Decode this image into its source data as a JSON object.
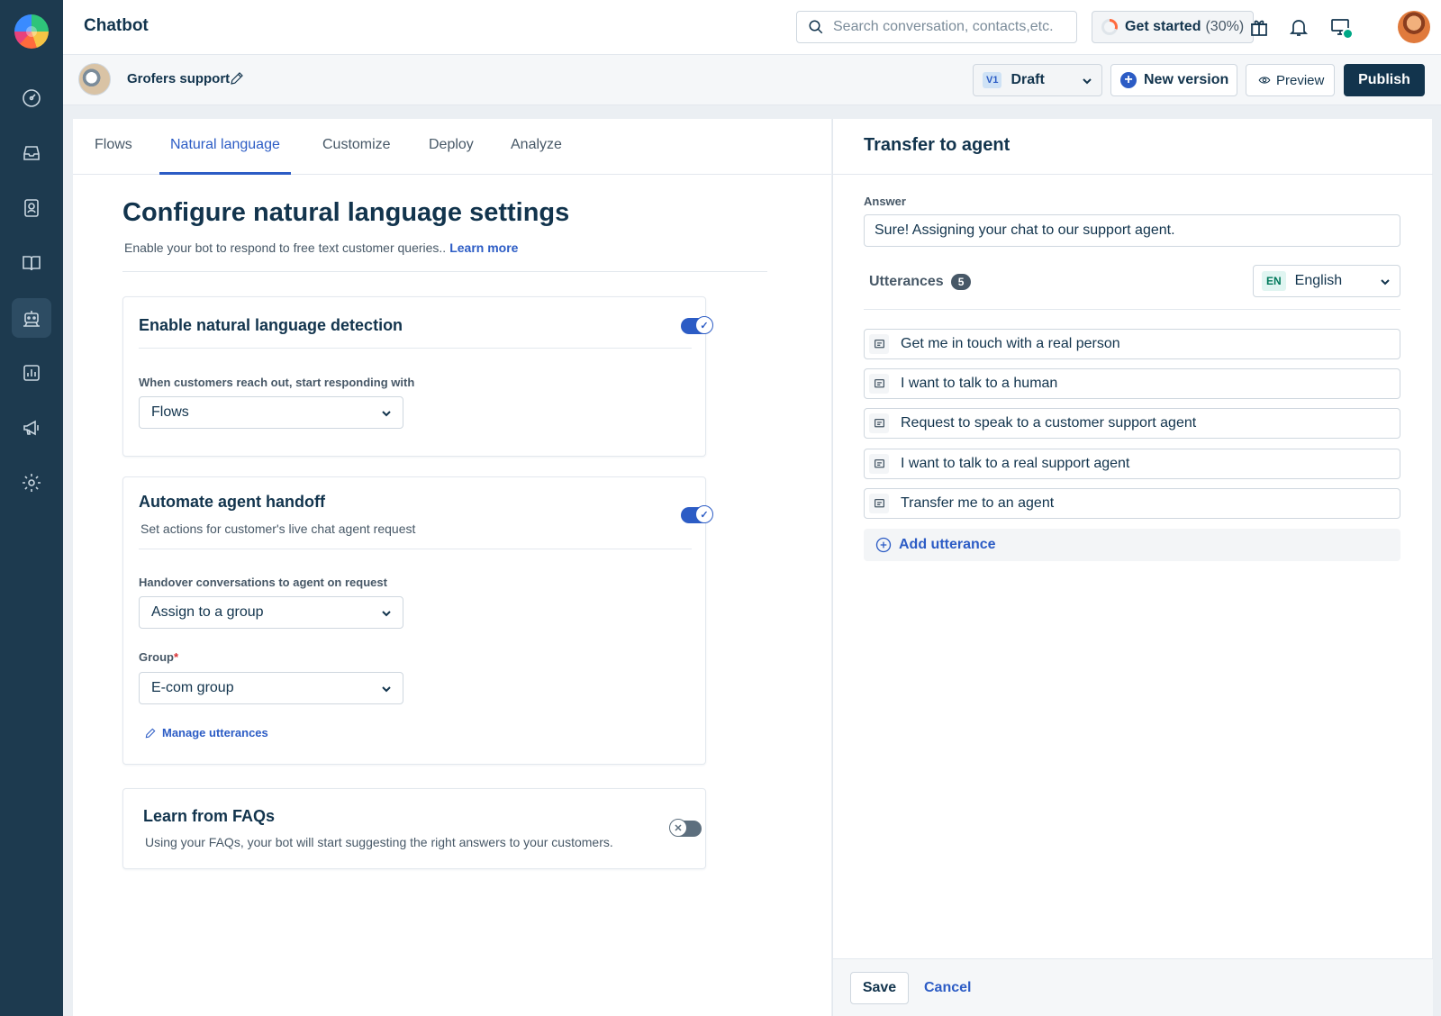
{
  "app": {
    "title": "Chatbot"
  },
  "topbar": {
    "search_placeholder": "Search conversation, contacts,etc.",
    "get_started_label": "Get started",
    "get_started_percent": "(30%)",
    "progress": 0.3
  },
  "sidebar": {
    "items": [
      {
        "icon": "dashboard-icon"
      },
      {
        "icon": "inbox-icon"
      },
      {
        "icon": "contacts-icon"
      },
      {
        "icon": "knowledge-base-icon"
      },
      {
        "icon": "bot-icon",
        "active": true
      },
      {
        "icon": "analytics-icon"
      },
      {
        "icon": "campaigns-icon"
      },
      {
        "icon": "settings-icon"
      }
    ]
  },
  "bot": {
    "name": "Grofers support",
    "version_badge": "V1",
    "version_status": "Draft",
    "new_version_label": "New version",
    "preview_label": "Preview",
    "publish_label": "Publish"
  },
  "tabs": [
    {
      "label": "Flows"
    },
    {
      "label": "Natural language",
      "active": true
    },
    {
      "label": "Customize"
    },
    {
      "label": "Deploy"
    },
    {
      "label": "Analyze"
    }
  ],
  "main": {
    "title": "Configure natural language settings",
    "subtitle": "Enable your bot to respond to free text customer queries..",
    "learn_more": "Learn more",
    "nl_card": {
      "title": "Enable natural language detection",
      "enabled": true,
      "field_label": "When customers reach out, start responding with",
      "field_value": "Flows"
    },
    "handoff_card": {
      "title": "Automate agent handoff",
      "description": "Set actions for customer's live chat agent request",
      "enabled": true,
      "handover_label": "Handover conversations to agent on request",
      "handover_value": "Assign to a group",
      "group_label": "Group",
      "group_required_mark": "*",
      "group_value": "E-com group",
      "manage_label": "Manage utterances"
    },
    "faq_card": {
      "title": "Learn from FAQs",
      "description": "Using your FAQs, your bot will start suggesting the right answers to your customers.",
      "enabled": false
    }
  },
  "panel": {
    "title": "Transfer to agent",
    "answer_label": "Answer",
    "answer_value": "Sure! Assigning your chat to our support agent.",
    "utterances_label": "Utterances",
    "utterances_count": "5",
    "language_code": "EN",
    "language_name": "English",
    "utterances": [
      "Get me in touch with a real person",
      "I want to talk to a human",
      "Request to speak to a customer support agent",
      "I want to talk to a real support agent",
      "Transfer me to an agent"
    ],
    "add_utterance_label": "Add utterance",
    "save_label": "Save",
    "cancel_label": "Cancel"
  },
  "colors": {
    "sidebar_bg": "#1d3a4f",
    "primary": "#2c5cc5",
    "publish_bg": "#12344d",
    "text": "#12344d"
  }
}
